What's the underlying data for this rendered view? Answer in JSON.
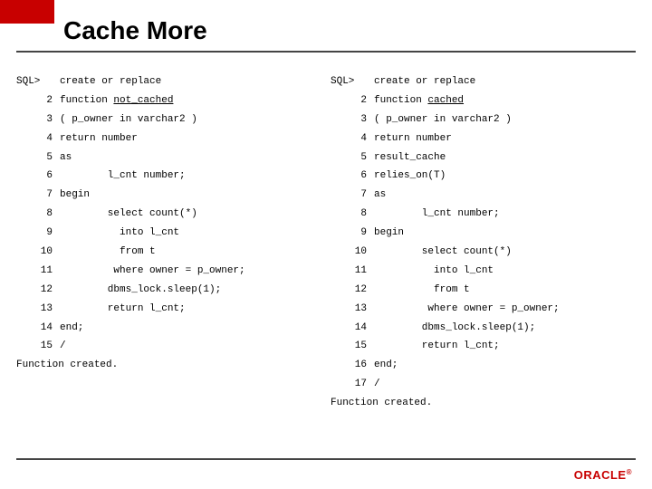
{
  "title": "Cache More",
  "left": {
    "lines": [
      {
        "n": "SQL>",
        "t": "create or replace",
        "prompt": true
      },
      {
        "n": "2",
        "t": "function ",
        "u": "not_cached"
      },
      {
        "n": "3",
        "t": "( p_owner in varchar2 )"
      },
      {
        "n": "4",
        "t": "return number"
      },
      {
        "n": "5",
        "t": "as"
      },
      {
        "n": "6",
        "t": "        l_cnt number;"
      },
      {
        "n": "7",
        "t": "begin"
      },
      {
        "n": "8",
        "t": "        select count(*)"
      },
      {
        "n": "9",
        "t": "          into l_cnt"
      },
      {
        "n": "10",
        "t": "          from t"
      },
      {
        "n": "11",
        "t": "         where owner = p_owner;"
      },
      {
        "n": "12",
        "t": "        dbms_lock.sleep(1);"
      },
      {
        "n": "13",
        "t": "        return l_cnt;"
      },
      {
        "n": "14",
        "t": "end;"
      },
      {
        "n": "15",
        "t": "/"
      }
    ],
    "result": "Function created."
  },
  "right": {
    "lines": [
      {
        "n": "SQL>",
        "t": "create or replace",
        "prompt": true
      },
      {
        "n": "2",
        "t": "function ",
        "u": "cached"
      },
      {
        "n": "3",
        "t": "( p_owner in varchar2 )"
      },
      {
        "n": "4",
        "t": "return number"
      },
      {
        "n": "5",
        "t": "result_cache"
      },
      {
        "n": "6",
        "t": "relies_on(T)"
      },
      {
        "n": "7",
        "t": "as"
      },
      {
        "n": "8",
        "t": "        l_cnt number;"
      },
      {
        "n": "9",
        "t": "begin"
      },
      {
        "n": "10",
        "t": "        select count(*)"
      },
      {
        "n": "11",
        "t": "          into l_cnt"
      },
      {
        "n": "12",
        "t": "          from t"
      },
      {
        "n": "13",
        "t": "         where owner = p_owner;"
      },
      {
        "n": "14",
        "t": "        dbms_lock.sleep(1);"
      },
      {
        "n": "15",
        "t": "        return l_cnt;"
      },
      {
        "n": "16",
        "t": "end;"
      },
      {
        "n": "17",
        "t": "/"
      }
    ],
    "result": "Function created."
  },
  "logo": "ORACLE",
  "logo_reg": "®"
}
